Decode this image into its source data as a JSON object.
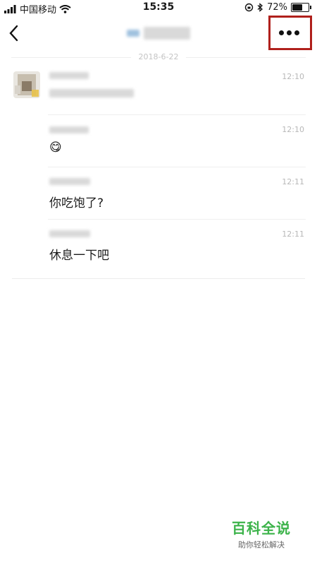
{
  "status_bar": {
    "carrier": "中国移动",
    "time": "15:35",
    "battery_percent": "72%",
    "battery_level": 0.72
  },
  "nav": {
    "icons": {
      "back": "chevron-left-icon",
      "more": "more-dots-icon"
    }
  },
  "chat": {
    "date": "2018-6-22",
    "messages": [
      {
        "time": "12:10",
        "text": ""
      },
      {
        "time": "12:10",
        "text": "😋"
      },
      {
        "time": "12:11",
        "text": "你吃饱了?"
      },
      {
        "time": "12:11",
        "text": "休息一下吧"
      }
    ]
  },
  "watermark": {
    "title": "百科全说",
    "subtitle": "助你轻松解决"
  },
  "colors": {
    "highlight": "#b0201c",
    "watermark": "#3cb34a"
  }
}
